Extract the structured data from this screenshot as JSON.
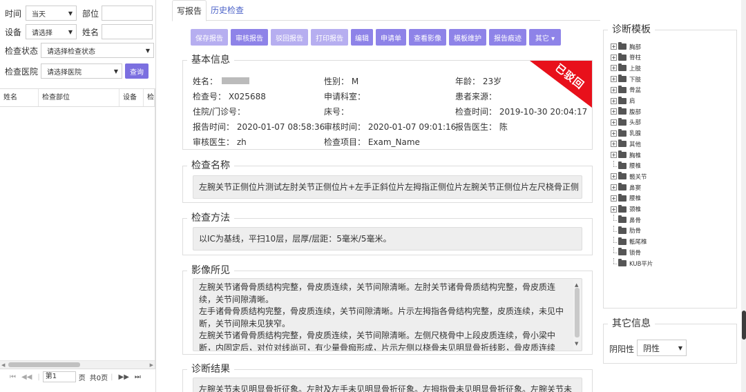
{
  "filters": {
    "time_label": "时间",
    "time_value": "当天",
    "part_label": "部位",
    "device_label": "设备",
    "device_value": "请选择",
    "name_label": "姓名",
    "status_label": "检查状态",
    "status_value": "请选择检查状态",
    "hospital_label": "检查医院",
    "hospital_value": "请选择医院",
    "query_button": "查询"
  },
  "grid": {
    "columns": [
      "姓名",
      "检查部位",
      "设备",
      "检"
    ]
  },
  "pager": {
    "page_prefix": "第",
    "page_value": "1",
    "page_suffix": "页",
    "total": "共0页"
  },
  "tabs": [
    {
      "label": "写报告",
      "active": true
    },
    {
      "label": "历史检查",
      "active": false
    }
  ],
  "toolbar": [
    "保存报告",
    "审核报告",
    "驳回报告",
    "打印报告",
    "编辑",
    "申请单",
    "查看影像",
    "模板维护",
    "报告痕迹",
    "其它 ▾"
  ],
  "basic": {
    "legend": "基本信息",
    "stamp": "已驳回",
    "name_label": "姓名：",
    "gender": "性别： M",
    "age": "年龄： 23岁",
    "exam_no": "检查号： X025688",
    "dept": "申请科室：",
    "source": "患者来源：",
    "inpatient": "住院/门诊号：",
    "bed": "床号：",
    "exam_time": "检查时间： 2019-10-30 20:04:17",
    "report_time": "报告时间： 2020-01-07 08:58:36",
    "review_time": "审核时间： 2020-01-07 09:01:16",
    "report_doctor": "报告医生： 陈",
    "review_doctor": "审核医生： zh",
    "exam_item": "检查项目： Exam_Name"
  },
  "exam_name": {
    "legend": "检查名称",
    "value": "左腕关节正侧位片测试左肘关节正侧位片+左手正斜位片左拇指正侧位片左腕关节正侧位片左尺桡骨正侧"
  },
  "exam_method": {
    "legend": "检查方法",
    "value": "以IC为基线，平扫10层，层厚/层距：5毫米/5毫米。"
  },
  "findings": {
    "legend": "影像所见",
    "lines": [
      "左腕关节诸骨骨质结构完整，骨皮质连续，关节间隙清晰。左肘关节诸骨骨质结构完整，骨皮质连续，关节间隙清晰。",
      "左手诸骨骨质结构完整，骨皮质连续，关节间隙清晰。片示左拇指各骨结构完整，皮质连续，未见中断，关节间隙未见狭窄。",
      "左腕关节诸骨骨质结构完整，骨皮质连续，关节间隙清晰。左侧尺桡骨中上段皮质连续，骨小梁中断，内固定后，对位对线尚可，有少量骨痂形成，片示左侧以桡骨未见明显骨折线影，骨皮质连续"
    ]
  },
  "diagnosis": {
    "legend": "诊断结果",
    "value": "左腕关节未见明显骨折征象。左肘及左手未见明显骨折征象。左拇指骨未见明显骨折征象。左腕关节未"
  },
  "template": {
    "legend": "诊断模板",
    "items": [
      {
        "label": "胸部",
        "expandable": true
      },
      {
        "label": "脊柱",
        "expandable": true
      },
      {
        "label": "上肢",
        "expandable": true
      },
      {
        "label": "下肢",
        "expandable": true
      },
      {
        "label": "骨盆",
        "expandable": true
      },
      {
        "label": "肩",
        "expandable": true
      },
      {
        "label": "腹部",
        "expandable": true
      },
      {
        "label": "头部",
        "expandable": true
      },
      {
        "label": "乳腺",
        "expandable": true
      },
      {
        "label": "其他",
        "expandable": true
      },
      {
        "label": "胸椎",
        "expandable": true
      },
      {
        "label": "腰椎",
        "expandable": false
      },
      {
        "label": "髋关节",
        "expandable": true
      },
      {
        "label": "鼻窦",
        "expandable": true
      },
      {
        "label": "腰椎",
        "expandable": true
      },
      {
        "label": "颈椎",
        "expandable": true
      },
      {
        "label": "鼻骨",
        "expandable": false
      },
      {
        "label": "肋骨",
        "expandable": false
      },
      {
        "label": "骶尾椎",
        "expandable": false
      },
      {
        "label": "锁骨",
        "expandable": false
      },
      {
        "label": "KUB平片",
        "expandable": false
      }
    ]
  },
  "other": {
    "legend": "其它信息",
    "yinyang_label": "阴阳性",
    "yinyang_value": "阴性"
  },
  "colors": {
    "button": "#8e83e8",
    "button_light": "#b6aef0",
    "stamp": "#e8101b",
    "tab_link": "#4b62c8"
  }
}
